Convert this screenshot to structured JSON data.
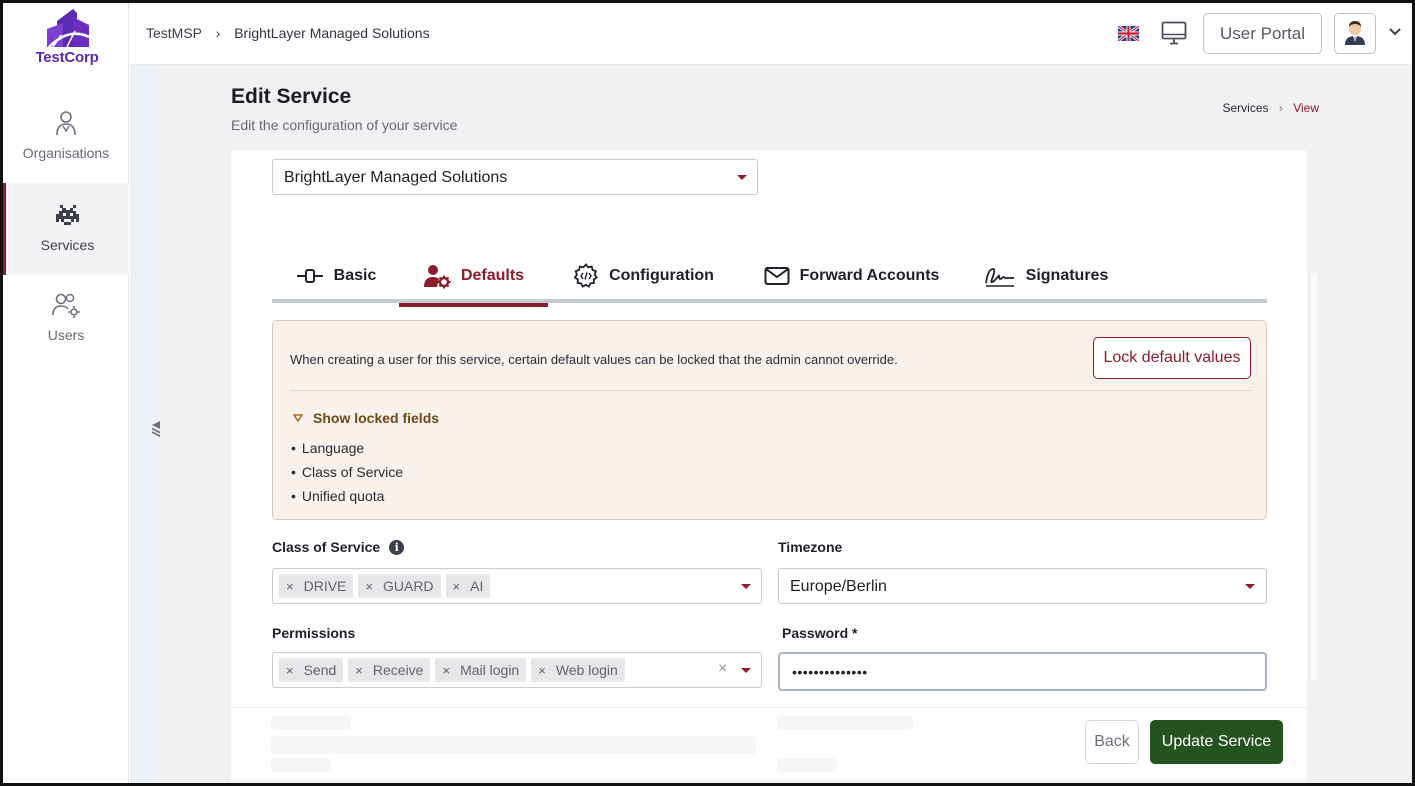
{
  "brand": {
    "name": "TestCorp",
    "color": "#5a2bb0"
  },
  "sidebar": {
    "items": [
      {
        "label": "Organisations",
        "icon": "organisation-icon"
      },
      {
        "label": "Services",
        "icon": "space-invader-icon"
      },
      {
        "label": "Users",
        "icon": "users-gear-icon"
      }
    ]
  },
  "topbar": {
    "breadcrumb": [
      "TestMSP",
      "BrightLayer Managed Solutions"
    ],
    "language_icon": "uk-flag-icon",
    "user_portal_label": "User Portal"
  },
  "page": {
    "title": "Edit Service",
    "subtitle": "Edit the configuration of your service",
    "breadcrumb": [
      "Services",
      "View"
    ]
  },
  "organisation_select": {
    "value": "BrightLayer Managed Solutions"
  },
  "tabs": [
    {
      "label": "Basic",
      "icon": "toggle-icon"
    },
    {
      "label": "Defaults",
      "icon": "user-gear-icon",
      "active": true
    },
    {
      "label": "Configuration",
      "icon": "gear-code-icon"
    },
    {
      "label": "Forward Accounts",
      "icon": "envelope-icon"
    },
    {
      "label": "Signatures",
      "icon": "signature-icon"
    }
  ],
  "info_box": {
    "text": "When creating a user for this service, certain default values can be locked that the admin cannot override.",
    "lock_button": "Lock default values",
    "toggle_label": "Show locked fields",
    "locked_fields": [
      "Language",
      "Class of Service",
      "Unified quota"
    ]
  },
  "form": {
    "class_of_service": {
      "label": "Class of Service",
      "chips": [
        "DRIVE",
        "GUARD",
        "AI"
      ]
    },
    "timezone": {
      "label": "Timezone",
      "value": "Europe/Berlin"
    },
    "permissions": {
      "label": "Permissions",
      "chips": [
        "Send",
        "Receive",
        "Mail login",
        "Web login"
      ]
    },
    "password": {
      "label": "Password *",
      "value": "••••••••••••••"
    }
  },
  "footer": {
    "back_label": "Back",
    "update_label": "Update Service"
  },
  "colors": {
    "accent": "#8b1e2d",
    "primary_button": "#25531f",
    "info_bg": "#f8f1ec"
  }
}
